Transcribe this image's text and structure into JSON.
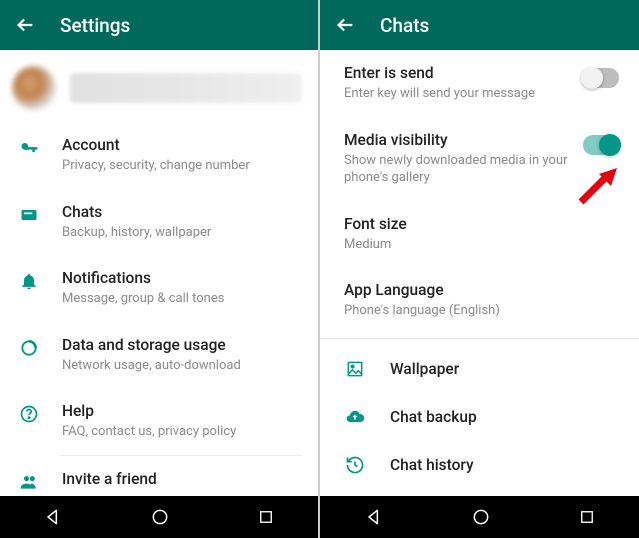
{
  "left": {
    "appbar_title": "Settings",
    "items": [
      {
        "title": "Account",
        "sub": "Privacy, security, change number"
      },
      {
        "title": "Chats",
        "sub": "Backup, history, wallpaper"
      },
      {
        "title": "Notifications",
        "sub": "Message, group & call tones"
      },
      {
        "title": "Data and storage usage",
        "sub": "Network usage, auto-download"
      },
      {
        "title": "Help",
        "sub": "FAQ, contact us, privacy policy"
      },
      {
        "title": "Invite a friend"
      }
    ]
  },
  "right": {
    "appbar_title": "Chats",
    "settings": [
      {
        "title": "Enter is send",
        "sub": "Enter key will send your message",
        "toggled": false
      },
      {
        "title": "Media visibility",
        "sub": "Show newly downloaded media in your phone's gallery",
        "toggled": true
      },
      {
        "title": "Font size",
        "sub": "Medium"
      },
      {
        "title": "App Language",
        "sub": "Phone's language (English)"
      }
    ],
    "actions": [
      {
        "title": "Wallpaper"
      },
      {
        "title": "Chat backup"
      },
      {
        "title": "Chat history"
      }
    ]
  },
  "colors": {
    "primary": "#00695c",
    "accent": "#009688"
  }
}
